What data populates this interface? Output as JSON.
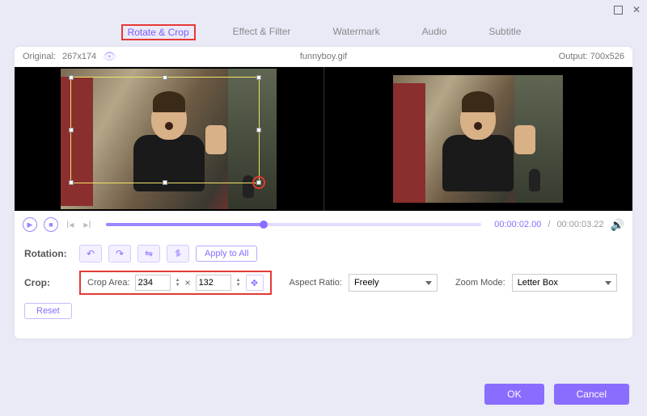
{
  "window": {
    "filename": "funnyboy.gif"
  },
  "tabs": {
    "rotate_crop": "Rotate & Crop",
    "effect_filter": "Effect & Filter",
    "watermark": "Watermark",
    "audio": "Audio",
    "subtitle": "Subtitle"
  },
  "dims": {
    "original_label": "Original:",
    "original_value": "267x174",
    "output_label": "Output:",
    "output_value": "700x526"
  },
  "playback": {
    "current": "00:00:02.00",
    "total": "00:00:03.22",
    "separator": "/"
  },
  "rotation": {
    "label": "Rotation:",
    "apply_all": "Apply to All"
  },
  "crop": {
    "label": "Crop:",
    "area_label": "Crop Area:",
    "width": "234",
    "height": "132",
    "times": "×",
    "aspect_label": "Aspect Ratio:",
    "aspect_value": "Freely",
    "zoom_label": "Zoom Mode:",
    "zoom_value": "Letter Box"
  },
  "buttons": {
    "reset": "Reset",
    "ok": "OK",
    "cancel": "Cancel"
  }
}
